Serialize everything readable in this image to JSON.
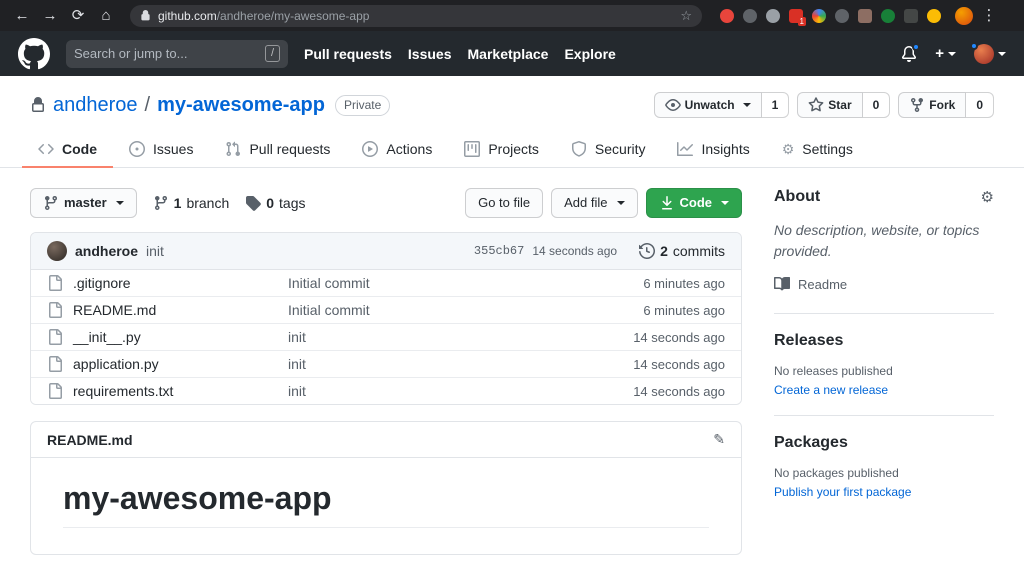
{
  "browser": {
    "url_host": "github.com",
    "url_path": "/andheroe/my-awesome-app",
    "extension_badge": "1"
  },
  "icons": {
    "back": "←",
    "forward": "→",
    "reload": "⟳",
    "home": "⌂",
    "menu": "⋮",
    "plus": "+",
    "bookmark_star": "☆",
    "gear": "⚙",
    "pencil": "✎"
  },
  "header": {
    "search_placeholder": "Search or jump to...",
    "search_key_hint": "/",
    "nav": [
      {
        "label": "Pull requests"
      },
      {
        "label": "Issues"
      },
      {
        "label": "Marketplace"
      },
      {
        "label": "Explore"
      }
    ]
  },
  "repo": {
    "owner": "andheroe",
    "separator": "/",
    "name": "my-awesome-app",
    "visibility": "Private",
    "unwatch_label": "Unwatch",
    "unwatch_count": "1",
    "star_label": "Star",
    "star_count": "0",
    "fork_label": "Fork",
    "fork_count": "0"
  },
  "tabs": [
    {
      "label": "Code"
    },
    {
      "label": "Issues"
    },
    {
      "label": "Pull requests"
    },
    {
      "label": "Actions"
    },
    {
      "label": "Projects"
    },
    {
      "label": "Security"
    },
    {
      "label": "Insights"
    },
    {
      "label": "Settings"
    }
  ],
  "toolbar": {
    "branch_button": "master",
    "branches_count": "1",
    "branches_label": "branch",
    "tags_count": "0",
    "tags_label": "tags",
    "goto_file_label": "Go to file",
    "add_file_label": "Add file",
    "code_label": "Code"
  },
  "commit": {
    "author": "andheroe",
    "message": "init",
    "sha": "355cb67",
    "time": "14 seconds ago",
    "count": "2",
    "count_label": "commits"
  },
  "files": [
    {
      "name": ".gitignore",
      "message": "Initial commit",
      "age": "6 minutes ago"
    },
    {
      "name": "README.md",
      "message": "Initial commit",
      "age": "6 minutes ago"
    },
    {
      "name": "__init__.py",
      "message": "init",
      "age": "14 seconds ago"
    },
    {
      "name": "application.py",
      "message": "init",
      "age": "14 seconds ago"
    },
    {
      "name": "requirements.txt",
      "message": "init",
      "age": "14 seconds ago"
    }
  ],
  "readme": {
    "filename": "README.md",
    "heading": "my-awesome-app"
  },
  "sidebar": {
    "about_title": "About",
    "about_description": "No description, website, or topics provided.",
    "readme_label": "Readme",
    "releases_title": "Releases",
    "releases_empty": "No releases published",
    "releases_link": "Create a new release",
    "packages_title": "Packages",
    "packages_empty": "No packages published",
    "packages_link": "Publish your first package"
  },
  "colors": {
    "accent_green": "#2ea44f",
    "link_blue": "#0366d6",
    "tab_underline": "#f9826c",
    "header_bg": "#24292e"
  }
}
